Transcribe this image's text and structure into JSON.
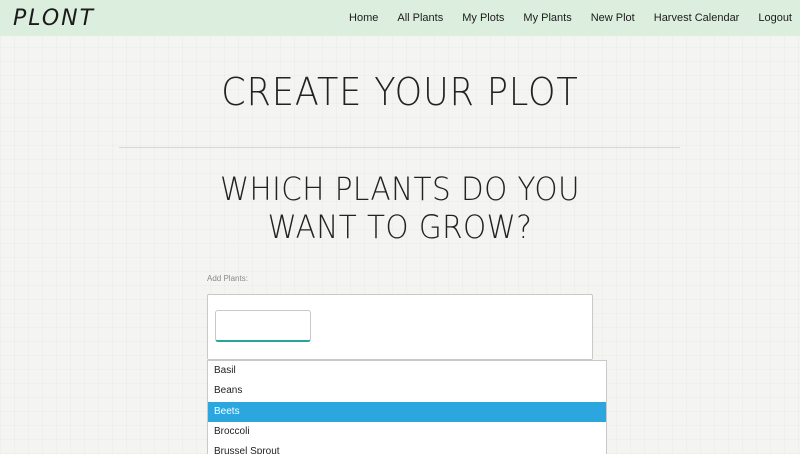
{
  "nav": {
    "brand": "PLONT",
    "links": [
      "Home",
      "All Plants",
      "My Plots",
      "My Plants",
      "New Plot",
      "Harvest Calendar",
      "Logout"
    ]
  },
  "main": {
    "page_title": "CREATE YOUR PLOT",
    "section_title_line1": "WHICH PLANTS DO YOU",
    "section_title_line2": "WANT TO GROW?",
    "add_label": "Add Plants:",
    "input_value": ""
  },
  "dropdown": {
    "options": [
      "Basil",
      "Beans",
      "Beets",
      "Broccoli",
      "Brussel Sprout"
    ],
    "selected": "Beets"
  },
  "colors": {
    "nav_bg": "#dcefdf",
    "highlight": "#2ca6df",
    "input_accent": "#26a69a"
  }
}
